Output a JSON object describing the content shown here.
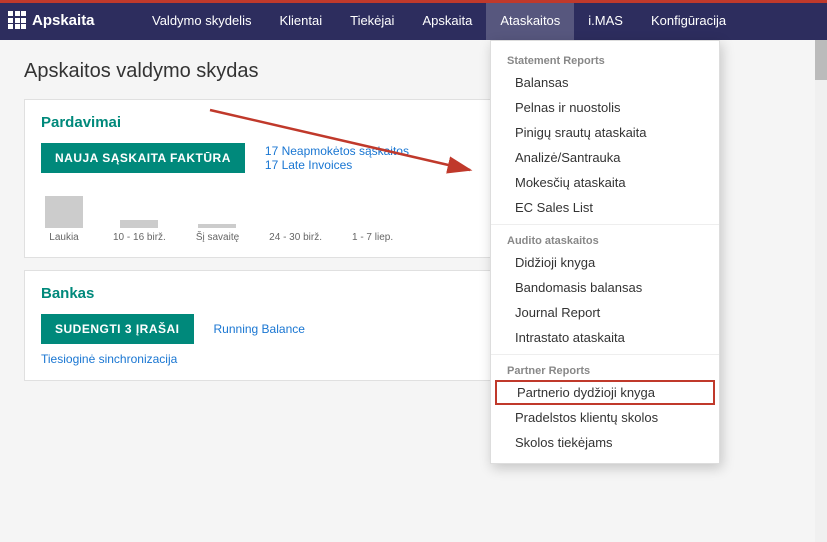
{
  "topAccent": true,
  "nav": {
    "logo": "Apskaita",
    "items": [
      {
        "label": "Valdymo skydelis",
        "active": false
      },
      {
        "label": "Klientai",
        "active": false
      },
      {
        "label": "Tiekėjai",
        "active": false
      },
      {
        "label": "Apskaita",
        "active": false
      },
      {
        "label": "Ataskaitos",
        "active": true
      },
      {
        "label": "i.MAS",
        "active": false
      },
      {
        "label": "Konfigūracija",
        "active": false
      }
    ]
  },
  "pageTitle": "Apskaitos valdymo skydas",
  "salesCard": {
    "title": "Pardavimai",
    "buttonLabel": "NAUJA SĄSKAITA FAKTŪRA",
    "link1": "17 Neapmokėtos sąskaitos",
    "link2": "17 Late Invoices",
    "chartBars": [
      {
        "label": "Laukia",
        "height": 32
      },
      {
        "label": "10 - 16 birž.",
        "height": 8
      },
      {
        "label": "Šį savaitę",
        "height": 4
      },
      {
        "label": "24 - 30 birž.",
        "height": 0
      },
      {
        "label": "1 - 7 liep.",
        "height": 0
      }
    ]
  },
  "bankCard": {
    "title": "Bankas",
    "buttonLabel": "SUDENGTI 3 ĮRAŠAI",
    "link1": "Running Balance",
    "link2": "Tiesioginė sinchronizacija"
  },
  "dropdown": {
    "section1": {
      "label": "Statement Reports",
      "items": [
        "Balansas",
        "Pelnas ir nuostolis",
        "Pinigų srautų ataskaita",
        "Analizė/Santrauka",
        "Mokesčių ataskaita",
        "EC Sales List"
      ]
    },
    "section2": {
      "label": "Audito ataskaitos",
      "items": [
        "Didžioji knyga",
        "Bandomasis balansas",
        "Journal Report",
        "Intrastato ataskaita"
      ]
    },
    "section3": {
      "label": "Partner Reports",
      "items": [
        "Partnerio dydžioji knyga",
        "Pradelstos klientų skolos",
        "Skolos tiekėjams"
      ],
      "highlighted": "Partnerio dydžioji knyga"
    }
  }
}
